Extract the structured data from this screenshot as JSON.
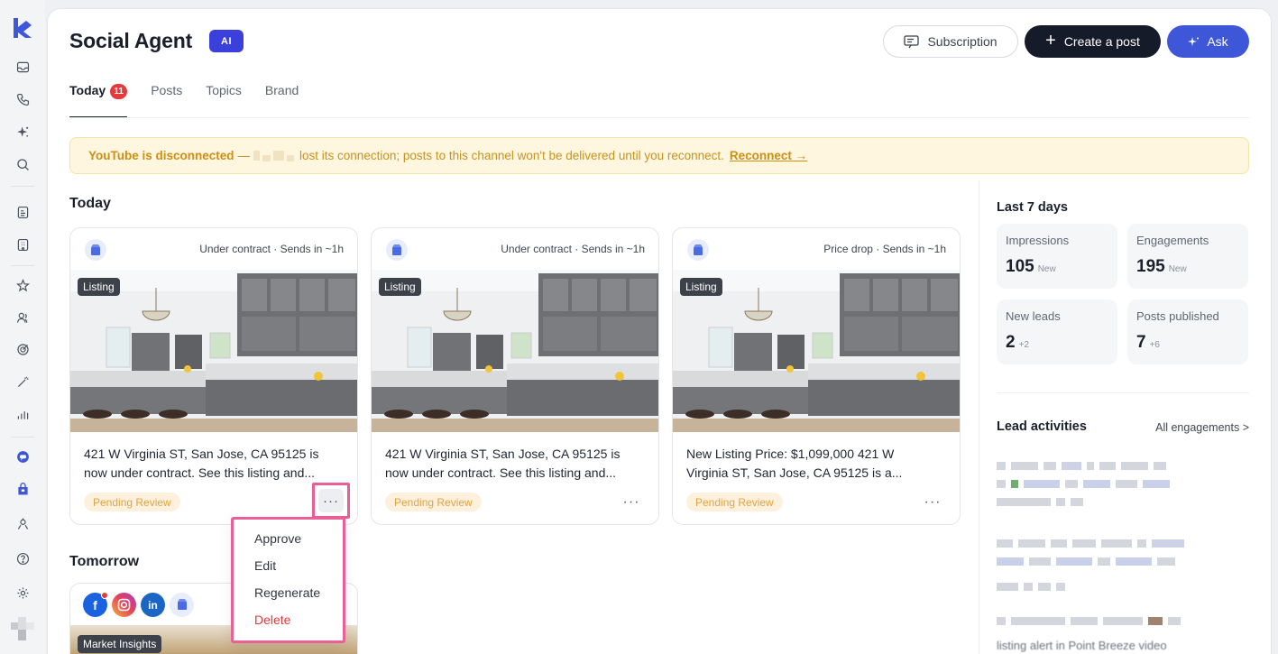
{
  "page": {
    "title": "Social Agent",
    "ai_badge": "AI"
  },
  "header": {
    "subscription_label": "Subscription",
    "create_post_label": "Create a post",
    "ask_label": "Ask"
  },
  "tabs": [
    {
      "label": "Today",
      "count": "11",
      "active": true
    },
    {
      "label": "Posts"
    },
    {
      "label": "Topics"
    },
    {
      "label": "Brand"
    }
  ],
  "banner": {
    "title": "YouTube is disconnected",
    "dash": "—",
    "message": "lost its connection; posts to this channel won't be delivered until you reconnect.",
    "action": "Reconnect →"
  },
  "today": {
    "heading": "Today",
    "cards": [
      {
        "status": "Under contract · Sends in ~1h",
        "tag": "Listing",
        "text_line1": "421 W Virginia ST, San Jose, CA 95125 is",
        "text_line2": "now under contract. See this listing and...",
        "pill": "Pending Review"
      },
      {
        "status": "Under contract · Sends in ~1h",
        "tag": "Listing",
        "text_line1": "421 W Virginia ST, San Jose, CA 95125 is",
        "text_line2": "now under contract. See this listing and...",
        "pill": "Pending Review"
      },
      {
        "status": "Price drop · Sends in ~1h",
        "tag": "Listing",
        "text_line1": "New Listing Price: $1,099,000 421 W",
        "text_line2": "Virginia ST, San Jose, CA 95125 is a...",
        "pill": "Pending Review"
      }
    ]
  },
  "menu": {
    "items": [
      "Approve",
      "Edit",
      "Regenerate",
      "Delete"
    ]
  },
  "tomorrow": {
    "heading": "Tomorrow",
    "tag": "Market Insights"
  },
  "stats": {
    "heading": "Last 7 days",
    "items": [
      {
        "label": "Impressions",
        "value": "105",
        "delta": "New"
      },
      {
        "label": "Engagements",
        "value": "195",
        "delta": "New"
      },
      {
        "label": "New leads",
        "value": "2",
        "delta": "+2"
      },
      {
        "label": "Posts published",
        "value": "7",
        "delta": "+6"
      }
    ]
  },
  "leads": {
    "heading": "Lead activities",
    "link": "All engagements >",
    "cut_text": "listing alert in Point Breeze video"
  },
  "colors": {
    "brand_blue": "#3d57d8",
    "ai_badge": "#3b3fdb",
    "danger": "#e5393b",
    "warning_text": "#d08e12",
    "highlight": "#ea5f95"
  }
}
